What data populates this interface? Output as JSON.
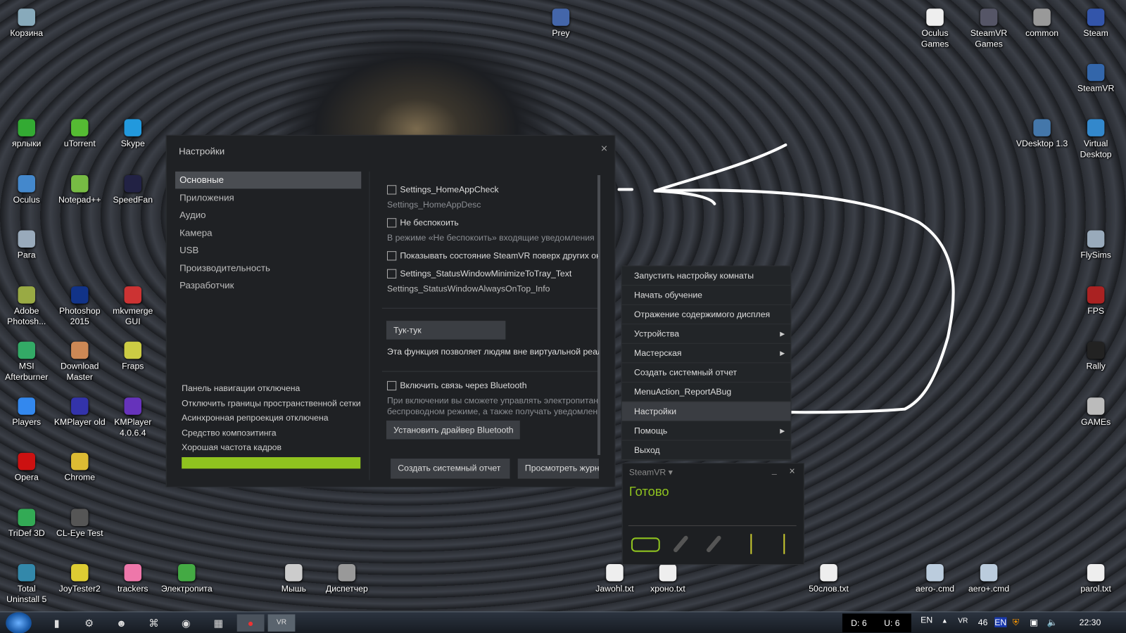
{
  "desktop_icons": [
    "Корзина",
    "Prey",
    "Oculus Games",
    "SteamVR Games",
    "common",
    "Steam",
    "SteamVR",
    "ярлыки",
    "uTorrent",
    "Skype",
    "VDesktop 1.3",
    "Virtual Desktop",
    "Oculus",
    "Notepad++",
    "SpeedFan",
    "Para",
    "FlySims",
    "Adobe Photosh...",
    "Photoshop 2015",
    "mkvmerge GUI",
    "FPS",
    "MSI Afterburner",
    "Download Master",
    "Fraps",
    "Rally",
    "Players",
    "KMPlayer old",
    "KMPlayer 4.0.6.4",
    "GAMEs",
    "Opera",
    "Chrome",
    "TriDef 3D",
    "CL-Eye Test",
    "Total Uninstall 5",
    "JoyTester2",
    "trackers",
    "Электропита",
    "Мышь",
    "Диспетчер",
    "Jawohl.txt",
    "хроно.txt",
    "50слов.txt",
    "aero-.cmd",
    "aero+.cmd",
    "parol.txt"
  ],
  "settings": {
    "title": "Настройки",
    "close": "×",
    "nav": [
      "Основные",
      "Приложения",
      "Аудио",
      "Камера",
      "USB",
      "Производительность",
      "Разработчик"
    ],
    "status": [
      "Панель навигации отключена",
      "Отключить границы пространственной сетки",
      "Асинхронная репроекция отключена",
      "Средство композитинга",
      "Хорошая частота кадров"
    ],
    "performance_fraction": 1.0,
    "home_check": "Settings_HomeAppCheck",
    "home_desc": "Settings_HomeAppDesc",
    "dnd_check": "Не беспокоить",
    "dnd_desc": "В режиме «Не беспокоить» входящие уведомления",
    "show_status_check": "Показывать состояние SteamVR поверх других ок",
    "minimize_check": "Settings_StatusWindowMinimizeToTray_Text",
    "minimize_info": "Settings_StatusWindowAlwaysOnTop_Info",
    "knock_button": "Тук-тук",
    "knock_desc": "Эта функция позволяет людям вне виртуальной реал",
    "bt_check": "Включить связь через Bluetooth",
    "bt_desc1": "При включении вы сможете управлять электропитани",
    "bt_desc2": "беспроводном режиме, а также получать уведомлен",
    "bt_driver_button": "Установить драйвер Bluetooth",
    "report_button": "Создать системный отчет",
    "log_button": "Просмотреть журн"
  },
  "context_menu": [
    {
      "label": "Запустить настройку комнаты"
    },
    {
      "label": "Начать обучение"
    },
    {
      "label": "Отражение содержимого дисплея"
    },
    {
      "label": "Устройства",
      "submenu": "▶"
    },
    {
      "label": "Мастерская",
      "submenu": "▶"
    },
    {
      "label": "Создать системный отчет"
    },
    {
      "label": "MenuAction_ReportABug"
    },
    {
      "label": "Настройки"
    },
    {
      "label": "Помощь",
      "submenu": "▶"
    },
    {
      "label": "Выход"
    }
  ],
  "steamvr_status": {
    "title": "SteamVR ▾",
    "minimize": "_",
    "close": "×",
    "state": "Готово",
    "accent": "#8fc31f"
  },
  "taskbar": {
    "disk": "D: 6",
    "upload": "U: 6",
    "lang": "EN",
    "lang2": "EN",
    "num": "46",
    "vr": "VR",
    "time": "22:30"
  }
}
